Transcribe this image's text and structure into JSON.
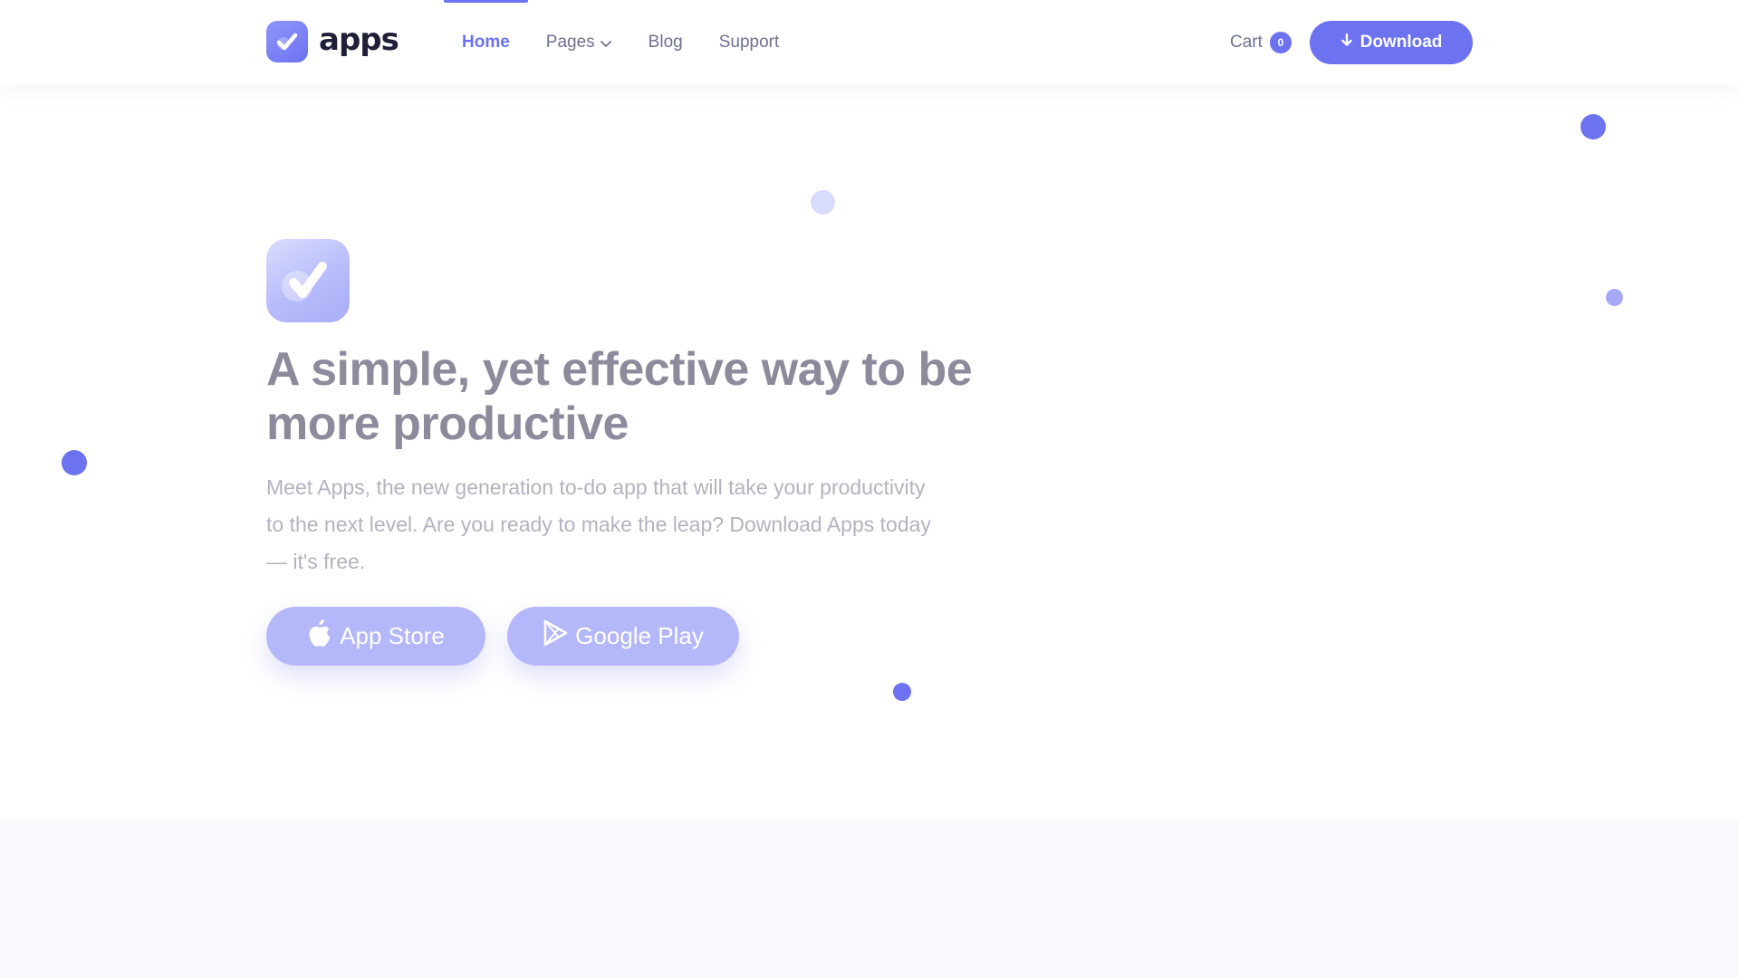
{
  "brand": {
    "name": "apps"
  },
  "nav": {
    "links": [
      {
        "label": "Home"
      },
      {
        "label": "Pages"
      },
      {
        "label": "Blog"
      },
      {
        "label": "Support"
      }
    ],
    "cart": {
      "label": "Cart",
      "count": "0"
    },
    "download_label": "Download"
  },
  "hero": {
    "title": "A simple, yet effective way to be more productive",
    "subtitle": "Meet Apps, the new generation to-do app that will take your productivity to the next level. Are you ready to make the leap? Download Apps today — it's free.",
    "buttons": {
      "app_store": "App Store",
      "google_play": "Google Play"
    }
  },
  "colors": {
    "accent": "#6c72f0",
    "accent_light": "#b4b7fa",
    "title": "#8c8b9c",
    "body_text": "#b3b3c1",
    "nav_text": "#6e7190",
    "band": "#f8f8fd"
  },
  "icons": [
    "check-logo-icon",
    "chevron-down-icon",
    "arrow-down-icon",
    "apple-icon",
    "google-play-icon",
    "check-icon"
  ]
}
